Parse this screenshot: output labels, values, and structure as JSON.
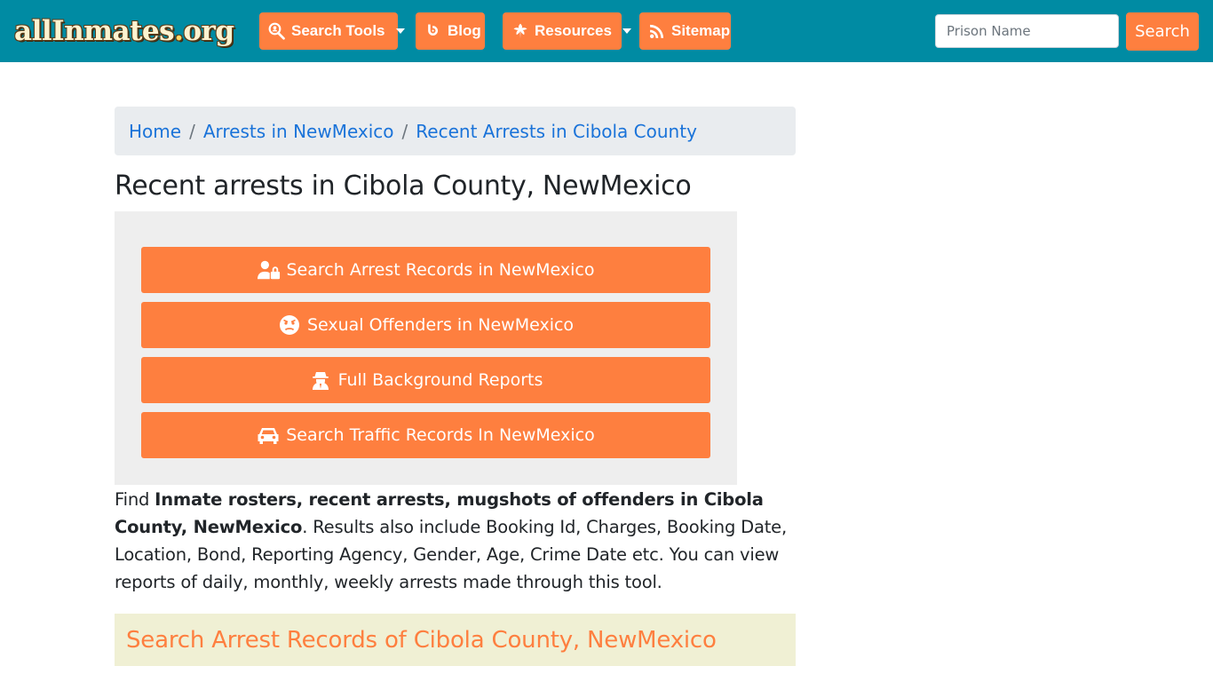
{
  "header": {
    "logo_text": "allInmates",
    "logo_dot": ".",
    "logo_suffix": "org",
    "nav": [
      {
        "label": "Search Tools",
        "icon": "search-person-icon",
        "dropdown": true
      },
      {
        "label": "Blog",
        "icon": "blogger-icon",
        "dropdown": false
      },
      {
        "label": "Resources",
        "icon": "leaf-icon",
        "dropdown": true
      },
      {
        "label": "Sitemap",
        "icon": "rss-icon",
        "dropdown": false
      }
    ],
    "search": {
      "placeholder": "Prison Name",
      "value": "",
      "button_label": "Search"
    }
  },
  "breadcrumb": {
    "items": [
      "Home",
      "Arrests in NewMexico",
      "Recent Arrests in Cibola County"
    ],
    "separator": "/"
  },
  "page_title": "Recent arrests in Cibola County, NewMexico",
  "actions": [
    {
      "label": "Search Arrest Records in NewMexico",
      "icon": "user-lock-icon"
    },
    {
      "label": "Sexual Offenders in NewMexico",
      "icon": "angry-face-icon"
    },
    {
      "label": "Full Background Reports",
      "icon": "user-secret-icon"
    },
    {
      "label": "Search Traffic Records In NewMexico",
      "icon": "car-icon"
    }
  ],
  "description": {
    "prefix": "Find ",
    "bold": "Inmate rosters, recent arrests, mugshots of offenders in Cibola County, NewMexico",
    "rest": ". Results also include Booking Id, Charges, Booking Date, Location, Bond, Reporting Agency, Gender, Age, Crime Date etc. You can view reports of daily, monthly, weekly arrests made through this tool."
  },
  "section_title": "Search Arrest Records of Cibola County, NewMexico",
  "colors": {
    "navbar": "#008ba3",
    "accent": "#fe7f3f",
    "link": "#1a73d9"
  }
}
